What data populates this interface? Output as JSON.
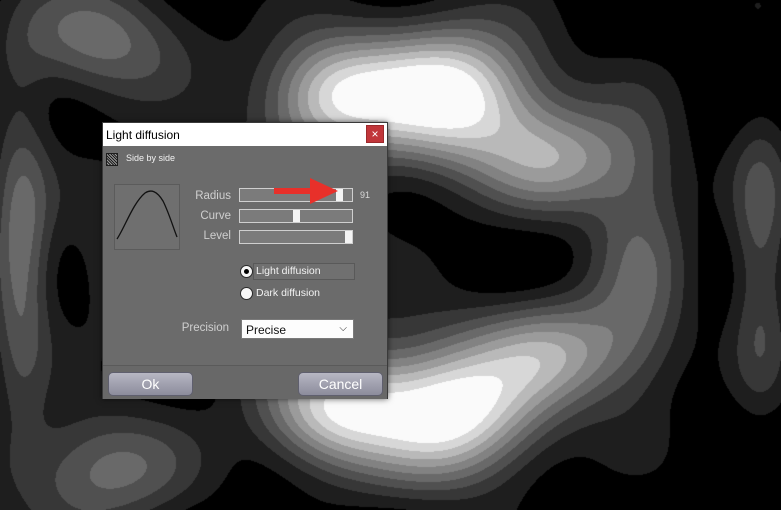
{
  "dialog": {
    "title": "Light diffusion",
    "close_label": "×",
    "side_by_side_label": "Side by side",
    "sliders": [
      {
        "label": "Radius",
        "value": "91",
        "level": 0.91
      },
      {
        "label": "Curve",
        "value": "",
        "level": 0.5
      },
      {
        "label": "Level",
        "value": "",
        "level": 1.0
      }
    ],
    "diffusion_options": [
      {
        "label": "Light diffusion",
        "checked": true
      },
      {
        "label": "Dark diffusion",
        "checked": false
      }
    ],
    "precision_label": "Precision",
    "precision_value": "Precise",
    "ok_label": "Ok",
    "cancel_label": "Cancel"
  },
  "colors": {
    "dialog_bg": "#6b6b6b",
    "close_button": "#c1363a",
    "arrow": "#e8302a"
  },
  "icons": {
    "close": "close-icon",
    "side_by_side": "side-by-side-icon",
    "select_chevron": "chevron-down-icon",
    "annotation": "red-arrow-icon"
  }
}
